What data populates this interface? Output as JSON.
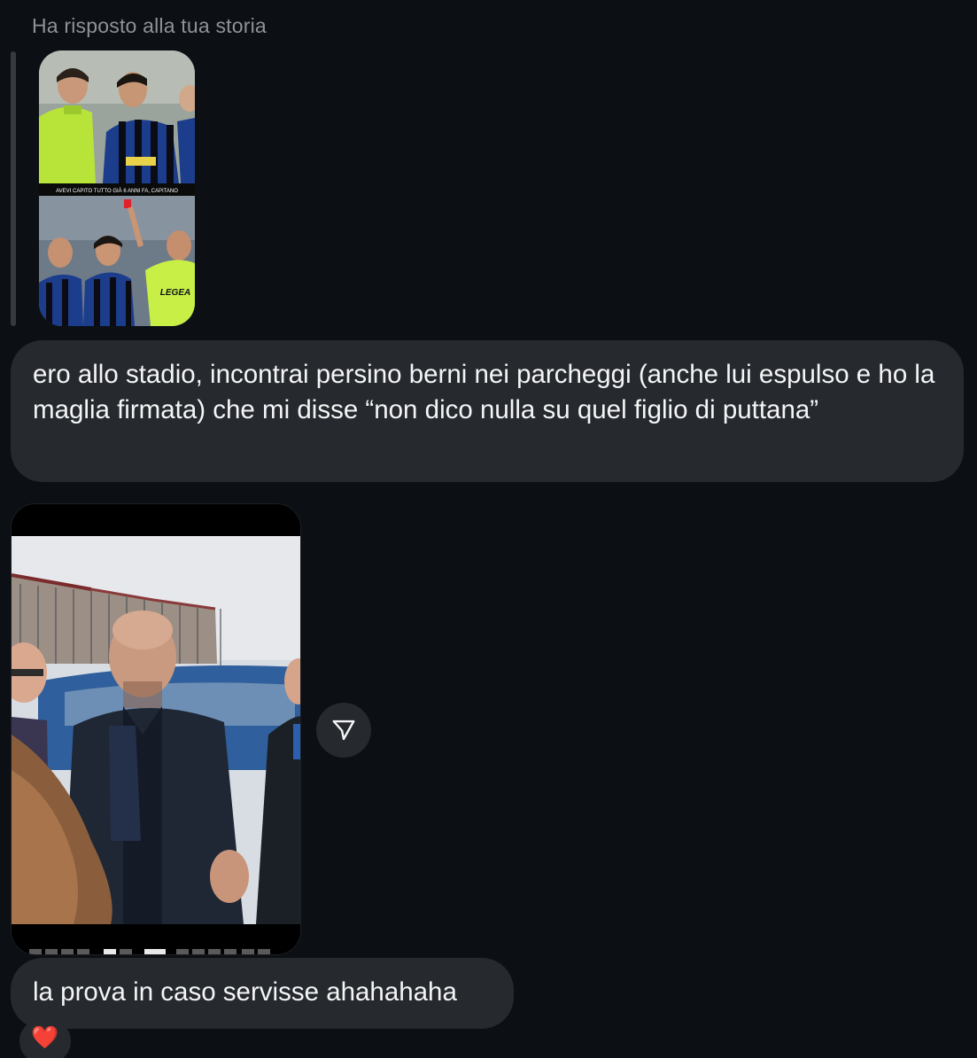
{
  "reply_label": "Ha risposto alla tua storia",
  "story": {
    "caption": "AVEVI CAPITO TUTTO GIÀ 6 ANNI FA, CAPITANO",
    "sponsor_text": "LEGEA"
  },
  "messages": {
    "first": "ero allo stadio, incontrai persino berni nei parcheggi (anche lui espulso e ho la maglia firmata) che mi disse “non dico nulla su quel figlio di puttana”",
    "second": "la prova in caso servisse ahahahaha"
  },
  "reaction": {
    "emoji": "❤️",
    "color": "#ff3040"
  },
  "icons": {
    "share": "paper-plane-icon",
    "reaction": "heart-icon"
  },
  "colors": {
    "background": "#0c1014",
    "bubble": "#26292e",
    "text": "#f4f5f6",
    "secondary_text": "#8e9299"
  }
}
